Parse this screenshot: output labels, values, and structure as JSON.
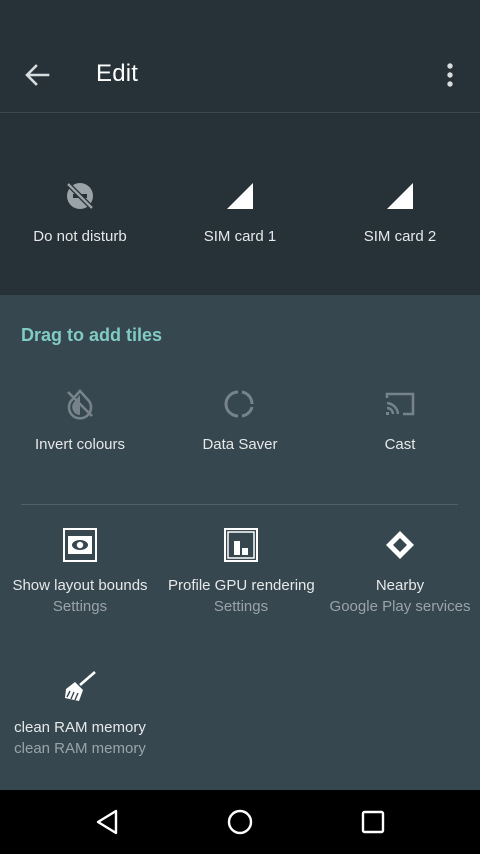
{
  "appbar": {
    "title": "Edit",
    "back_icon": "arrow-back-icon",
    "menu_icon": "more-vert-icon"
  },
  "active_tiles": [
    {
      "label": "Do not disturb",
      "icon": "do-not-disturb-off-icon"
    },
    {
      "label": "SIM card 1",
      "icon": "signal-cellular-icon"
    },
    {
      "label": "SIM card 2",
      "icon": "signal-cellular-icon"
    }
  ],
  "add_section": {
    "header": "Drag to add tiles",
    "system_tiles": [
      {
        "label": "Invert colours",
        "icon": "invert-colors-off-icon"
      },
      {
        "label": "Data Saver",
        "icon": "data-saver-icon"
      },
      {
        "label": "Cast",
        "icon": "cast-icon"
      }
    ],
    "app_tiles": [
      {
        "label": "Show layout bounds",
        "sub": "Settings",
        "icon": "layout-bounds-icon"
      },
      {
        "label": "Profile GPU rendering",
        "sub": "Settings",
        "icon": "gpu-profile-icon"
      },
      {
        "label": "Nearby",
        "sub": "Google Play services",
        "icon": "nearby-icon"
      },
      {
        "label": "clean RAM memory",
        "sub": "clean RAM memory",
        "icon": "broom-icon"
      }
    ]
  },
  "navbar": {
    "back_icon": "nav-back-icon",
    "home_icon": "nav-home-icon",
    "recents_icon": "nav-recents-icon"
  },
  "colors": {
    "top_background": "#263238",
    "tile_area_background": "#37474f",
    "accent": "#80cbc4",
    "nav_background": "#000000"
  }
}
